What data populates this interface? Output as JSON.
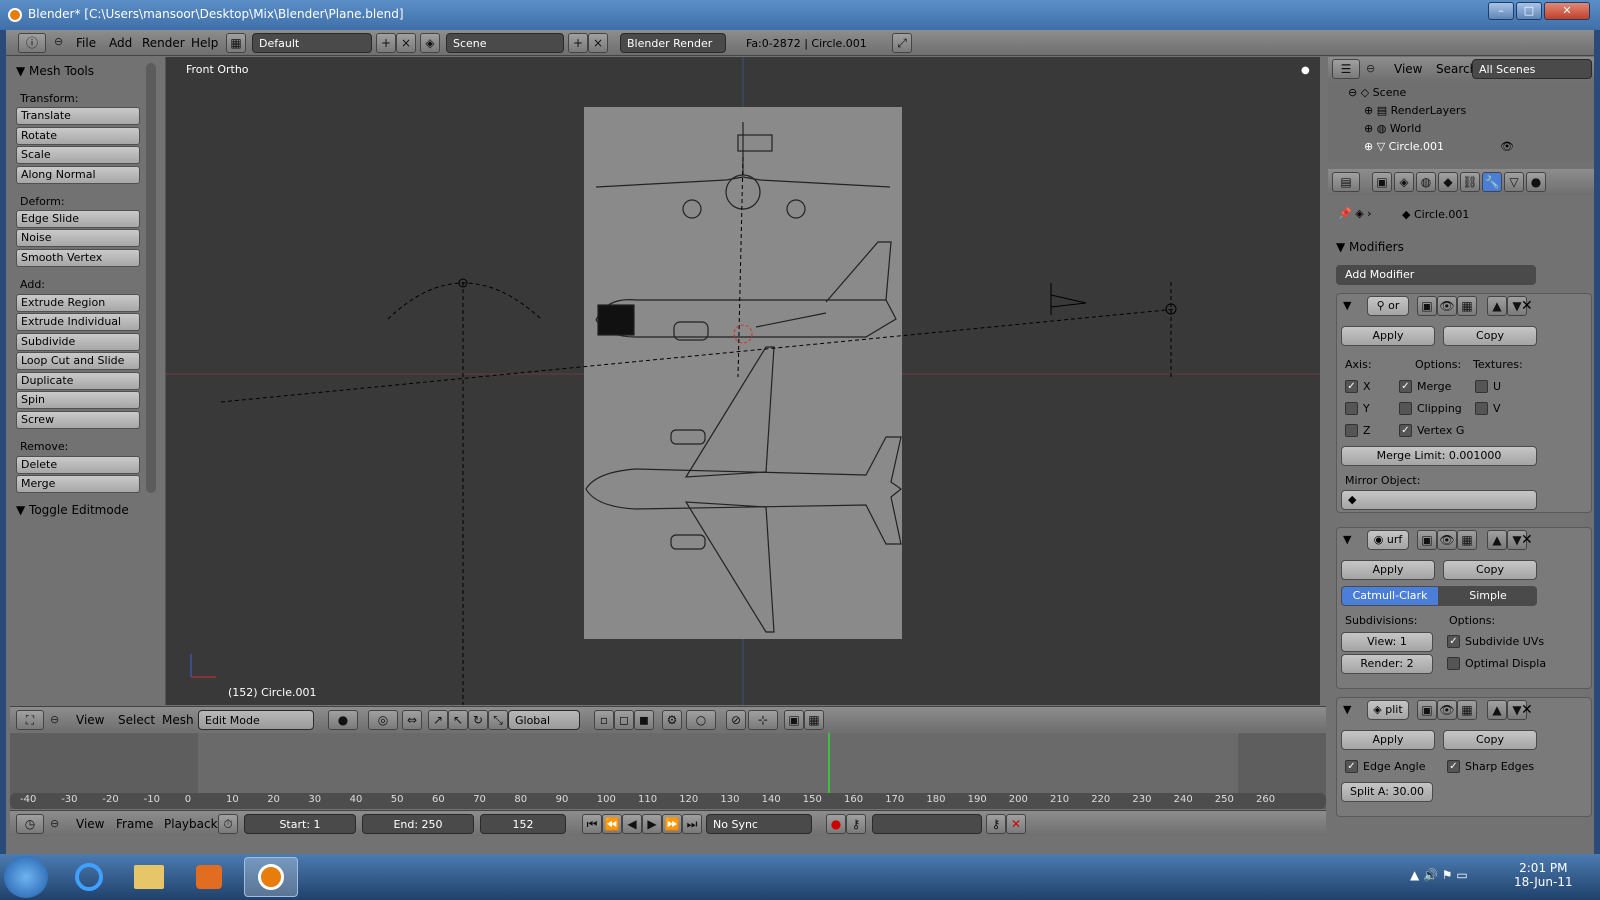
{
  "window": {
    "title": "Blender* [C:\\Users\\mansoor\\Desktop\\Mix\\Blender\\Plane.blend]",
    "minimize": "–",
    "maximize": "□",
    "close": "✕"
  },
  "topbar": {
    "menus": [
      "File",
      "Add",
      "Render",
      "Help"
    ],
    "screen_layout": "Default",
    "scene": "Scene",
    "render_engine": "Blender Render",
    "stats": "Fa:0-2872 | Circle.001"
  },
  "toolshelf": {
    "title": "Mesh Tools",
    "sections": [
      {
        "label": "Transform:",
        "buttons": [
          "Translate",
          "Rotate",
          "Scale",
          "Along Normal"
        ]
      },
      {
        "label": "Deform:",
        "buttons": [
          "Edge Slide",
          "Noise",
          "Smooth Vertex"
        ]
      },
      {
        "label": "Add:",
        "buttons": [
          "Extrude Region",
          "Extrude Individual",
          "Subdivide",
          "Loop Cut and Slide",
          "Duplicate",
          "Spin",
          "Screw"
        ]
      },
      {
        "label": "Remove:",
        "buttons": [
          "Delete",
          "Merge"
        ]
      }
    ],
    "toggle_editmode": "Toggle Editmode"
  },
  "viewport": {
    "view_name": "Front Ortho",
    "object_info": "(152) Circle.001"
  },
  "viewport_header": {
    "menus": [
      "View",
      "Select",
      "Mesh"
    ],
    "mode": "Edit Mode",
    "orientation": "Global"
  },
  "outliner": {
    "menus": [
      "View",
      "Search"
    ],
    "filter": "All Scenes",
    "items": [
      "Scene",
      "RenderLayers",
      "World",
      "Circle.001"
    ]
  },
  "properties": {
    "object_name": "Circle.001",
    "modifiers_title": "Modifiers",
    "add_modifier": "Add Modifier",
    "mirror": {
      "name": "or",
      "apply": "Apply",
      "copy": "Copy",
      "axis_label": "Axis:",
      "options_label": "Options:",
      "textures_label": "Textures:",
      "x": "X",
      "y": "Y",
      "z": "Z",
      "merge": "Merge",
      "clipping": "Clipping",
      "vertex_g": "Vertex G",
      "u": "U",
      "v": "V",
      "merge_limit": "Merge Limit: 0.001000",
      "mirror_object": "Mirror Object:"
    },
    "subsurf": {
      "name": "urf",
      "apply": "Apply",
      "copy": "Copy",
      "catmull": "Catmull-Clark",
      "simple": "Simple",
      "subdivisions_label": "Subdivisions:",
      "options_label": "Options:",
      "view": "View: 1",
      "render": "Render: 2",
      "subdivide_uvs": "Subdivide UVs",
      "optimal_display": "Optimal Displa"
    },
    "edgesplit": {
      "name": "plit",
      "apply": "Apply",
      "copy": "Copy",
      "edge_angle": "Edge Angle",
      "sharp_edges": "Sharp Edges",
      "split_angle": "Split A: 30.00"
    }
  },
  "timeline": {
    "ticks": [
      "-40",
      "-30",
      "-20",
      "-10",
      "0",
      "10",
      "20",
      "30",
      "40",
      "50",
      "60",
      "70",
      "80",
      "90",
      "100",
      "110",
      "120",
      "130",
      "140",
      "150",
      "160",
      "170",
      "180",
      "190",
      "200",
      "210",
      "220",
      "230",
      "240",
      "250",
      "260"
    ],
    "menus": [
      "View",
      "Frame",
      "Playback"
    ],
    "start": "Start: 1",
    "end": "End: 250",
    "current": "152",
    "sync": "No Sync"
  },
  "taskbar": {
    "time": "2:01 PM",
    "date": "18-Jun-11"
  },
  "colors": {
    "accent_blue": "#4a7ed9",
    "viewport_bg": "#393939",
    "panel_bg": "#727272"
  }
}
